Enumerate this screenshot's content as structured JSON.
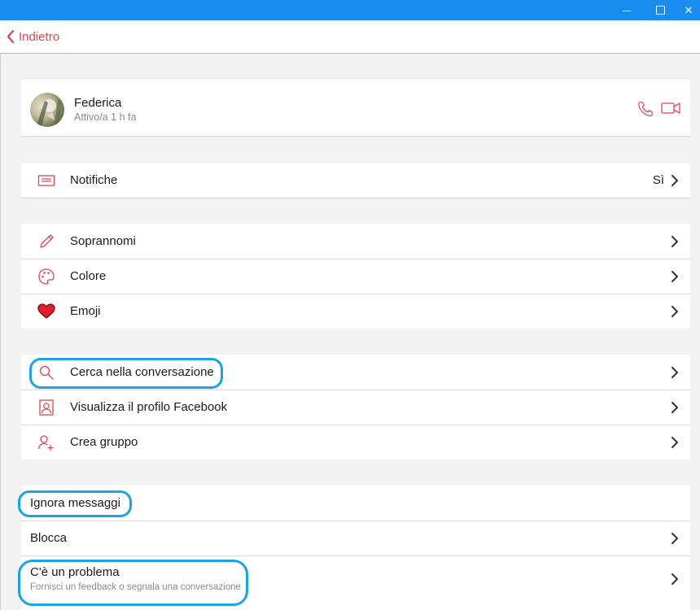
{
  "window": {
    "minimize_glyph": "–",
    "close_glyph": "✕"
  },
  "header": {
    "back_label": "Indietro"
  },
  "profile": {
    "name": "Federica",
    "status": "Attivo/a 1 h fa"
  },
  "notifications": {
    "label": "Notifiche",
    "value": "Sì"
  },
  "customize": [
    {
      "label": "Soprannomi",
      "icon": "pencil-icon"
    },
    {
      "label": "Colore",
      "icon": "palette-icon"
    },
    {
      "label": "Emoji",
      "icon": "heart-icon"
    }
  ],
  "actions": [
    {
      "label": "Cerca nella conversazione",
      "icon": "search-icon"
    },
    {
      "label": "Visualizza il profilo Facebook",
      "icon": "profile-icon"
    },
    {
      "label": "Crea gruppo",
      "icon": "add-person-icon"
    }
  ],
  "privacy": {
    "ignore_label": "Ignora messaggi",
    "block_label": "Blocca",
    "problem_label": "C'è un problema",
    "problem_sub": "Fornisci un feedback o segnala una conversazione"
  },
  "colors": {
    "accent": "#e0454f",
    "titlebar": "#1a8cf0",
    "highlight": "#1aa3e6"
  }
}
